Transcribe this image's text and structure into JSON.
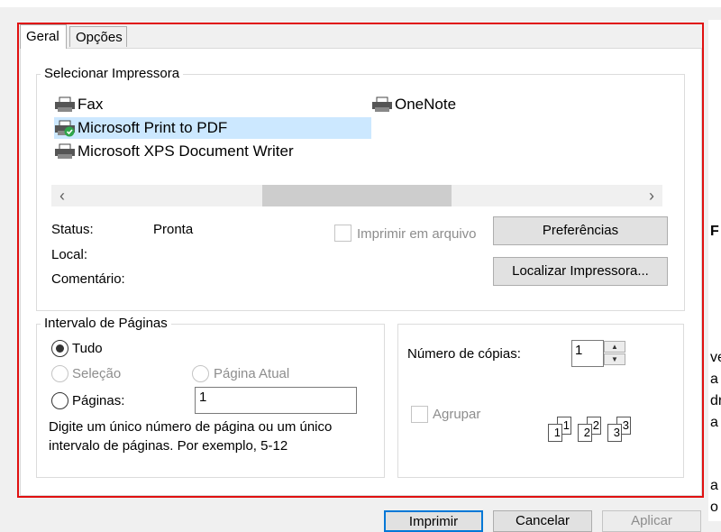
{
  "tabs": [
    {
      "label": "Geral"
    },
    {
      "label": "Opções"
    }
  ],
  "printer_group": {
    "label": "Selecionar Impressora",
    "printers": [
      {
        "name": "Fax",
        "icon": "printer-icon"
      },
      {
        "name": "Microsoft Print to PDF",
        "icon": "printer-default-icon",
        "selected": true
      },
      {
        "name": "Microsoft XPS Document Writer",
        "icon": "printer-icon"
      },
      {
        "name": "OneNote",
        "icon": "printer-icon"
      }
    ],
    "status_label": "Status:",
    "status_value": "Pronta",
    "location_label": "Local:",
    "comment_label": "Comentário:",
    "print_to_file_label": "Imprimir em arquivo",
    "preferences_button": "Preferências",
    "find_printer_button": "Localizar Impressora..."
  },
  "page_range": {
    "label": "Intervalo de Páginas",
    "all_label": "Tudo",
    "selection_label": "Seleção",
    "current_page_label": "Página Atual",
    "pages_label": "Páginas:",
    "pages_value": "1",
    "hint": "Digite um único número de página ou um único intervalo de páginas. Por exemplo, 5-12"
  },
  "copies": {
    "label": "Número de cópias:",
    "value": "1",
    "collate_label": "Agrupar",
    "collate_pages": [
      "1",
      "1",
      "2",
      "2",
      "3",
      "3"
    ]
  },
  "bottom_buttons": {
    "print": "Imprimir",
    "cancel": "Cancelar",
    "apply": "Aplicar"
  },
  "background_window_letters": [
    "F",
    "ve",
    "a",
    "dr",
    "a",
    "a",
    "o"
  ],
  "colors": {
    "highlight_frame": "#e01010",
    "selected_row": "#cce8ff"
  }
}
